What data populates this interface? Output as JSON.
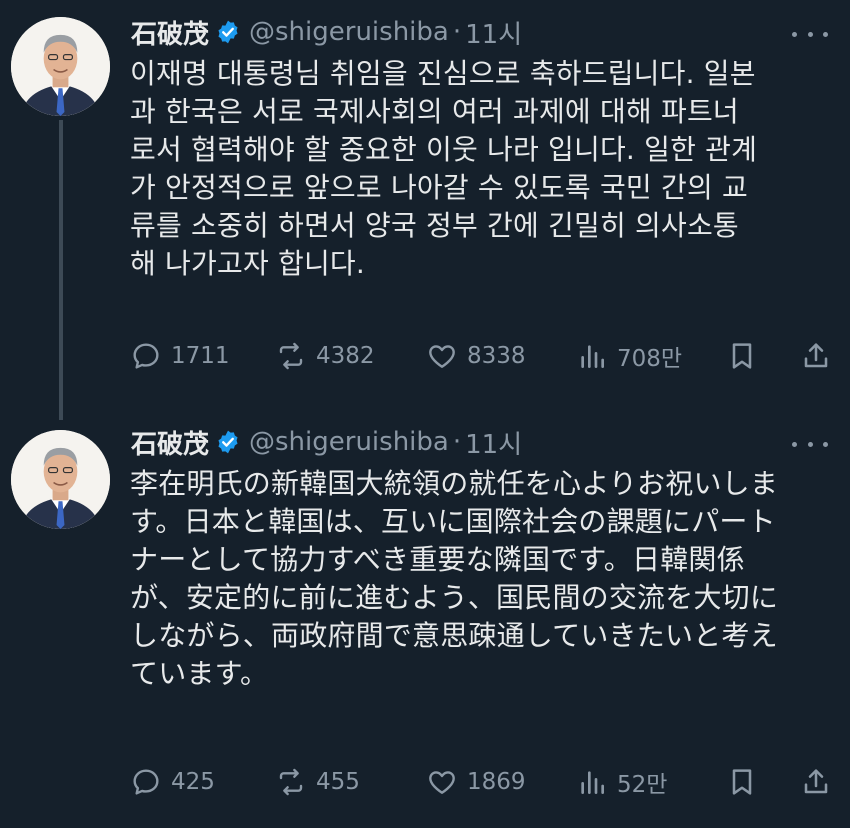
{
  "tweets": [
    {
      "author": {
        "name": "石破茂",
        "handle": "@shigeruishiba",
        "verified": true
      },
      "time": "11시",
      "text": "이재명 대통령님 취임을 진심으로 축하드립니다. 일본\n과 한국은 서로 국제사회의 여러 과제에 대해 파트너\n로서 협력해야 할 중요한 이웃 나라 입니다. 일한 관계\n가 안정적으로 앞으로 나아갈 수 있도록 국민 간의 교\n류를 소중히 하면서 양국 정부 간에 긴밀히 의사소통\n해 나가고자 합니다.",
      "stats": {
        "replies": "1711",
        "retweets": "4382",
        "likes": "8338",
        "views": "708만"
      }
    },
    {
      "author": {
        "name": "石破茂",
        "handle": "@shigeruishiba",
        "verified": true
      },
      "time": "11시",
      "text": "李在明氏の新韓国大統領の就任を心よりお祝いしま\nす。日本と韓国は、互いに国際社会の課題にパート\nナーとして協力すべき重要な隣国です。日韓関係\nが、安定的に前に進むよう、国民間の交流を大切に\nしながら、両政府間で意思疎通していきたいと考え\nています。",
      "stats": {
        "replies": "425",
        "retweets": "455",
        "likes": "1869",
        "views": "52만"
      }
    }
  ],
  "separator": "·",
  "icons": [
    "verified-badge-icon",
    "more-icon",
    "reply-icon",
    "retweet-icon",
    "like-icon",
    "views-icon",
    "bookmark-icon",
    "share-icon"
  ],
  "colors": {
    "background": "#15202b",
    "text": "#e7e9ea",
    "muted": "#8b98a5",
    "verified": "#1d9bf0",
    "thread_line": "#3d4a56"
  }
}
